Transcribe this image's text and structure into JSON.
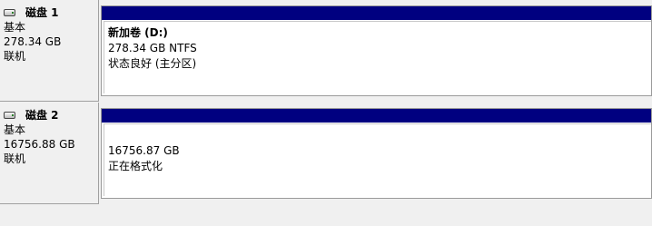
{
  "disks": [
    {
      "name": "磁盘 1",
      "type": "基本",
      "size": "278.34 GB",
      "status": "联机",
      "volume": {
        "title": "新加卷  (D:)",
        "size_fs": "278.34 GB NTFS",
        "status": "状态良好 (主分区)"
      }
    },
    {
      "name": "磁盘 2",
      "type": "基本",
      "size": "16756.88 GB",
      "status": "联机",
      "volume": {
        "title": "",
        "size_fs": "16756.87 GB",
        "status": "正在格式化"
      }
    }
  ]
}
